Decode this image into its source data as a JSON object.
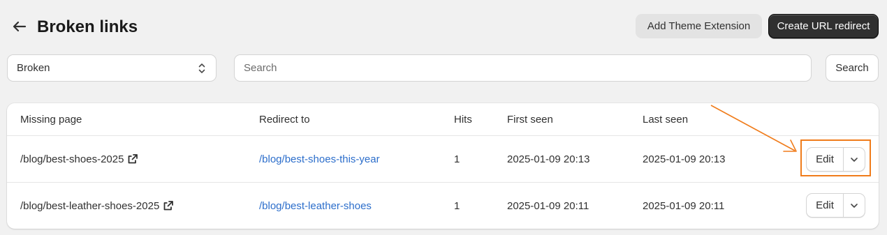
{
  "header": {
    "title": "Broken links",
    "secondary_button": "Add Theme Extension",
    "primary_button": "Create URL redirect"
  },
  "filters": {
    "status_select": "Broken",
    "search_placeholder": "Search",
    "search_button": "Search"
  },
  "table": {
    "columns": [
      "Missing page",
      "Redirect to",
      "Hits",
      "First seen",
      "Last seen"
    ],
    "rows": [
      {
        "missing_page": "/blog/best-shoes-2025",
        "redirect_to": "/blog/best-shoes-this-year",
        "hits": "1",
        "first_seen": "2025-01-09 20:13",
        "last_seen": "2025-01-09 20:13",
        "action": "Edit"
      },
      {
        "missing_page": "/blog/best-leather-shoes-2025",
        "redirect_to": "/blog/best-leather-shoes",
        "hits": "1",
        "first_seen": "2025-01-09 20:11",
        "last_seen": "2025-01-09 20:11",
        "action": "Edit"
      }
    ]
  },
  "icons": {
    "back": "arrow-left-icon",
    "select": "chevron-up-down-icon",
    "external": "external-link-icon",
    "more": "chevron-down-icon"
  },
  "colors": {
    "link": "#2c6ecb",
    "primary_button": "#303030",
    "annotation": "#f07c1b"
  }
}
